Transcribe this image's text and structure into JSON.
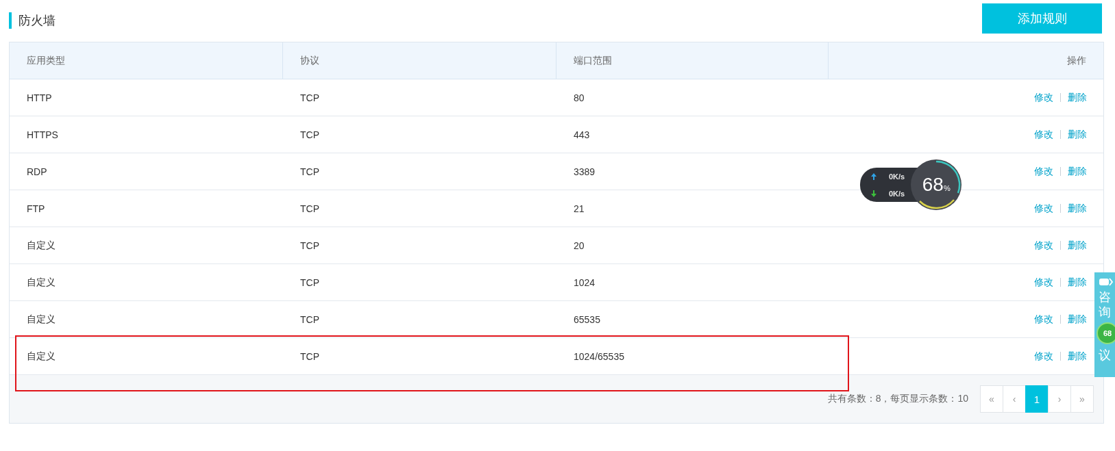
{
  "page_title": "防火墙",
  "add_button": "添加规则",
  "table": {
    "columns": [
      "应用类型",
      "协议",
      "端口范围",
      "操作"
    ],
    "rows": [
      {
        "cells": [
          "HTTP",
          "TCP",
          "80"
        ],
        "actions": [
          "修改",
          "删除"
        ]
      },
      {
        "cells": [
          "HTTPS",
          "TCP",
          "443"
        ],
        "actions": [
          "修改",
          "删除"
        ]
      },
      {
        "cells": [
          "RDP",
          "TCP",
          "3389"
        ],
        "actions": [
          "修改",
          "删除"
        ]
      },
      {
        "cells": [
          "FTP",
          "TCP",
          "21"
        ],
        "actions": [
          "修改",
          "删除"
        ]
      },
      {
        "cells": [
          "自定义",
          "TCP",
          "20"
        ],
        "actions": [
          "修改",
          "删除"
        ]
      },
      {
        "cells": [
          "自定义",
          "TCP",
          "1024"
        ],
        "actions": [
          "修改",
          "删除"
        ]
      },
      {
        "cells": [
          "自定义",
          "TCP",
          "65535"
        ],
        "actions": [
          "修改",
          "删除"
        ]
      },
      {
        "cells": [
          "自定义",
          "TCP",
          "1024/65535"
        ],
        "actions": [
          "修改",
          "删除"
        ]
      }
    ]
  },
  "pagination": {
    "summary": "共有条数：8，每页显示条数：10",
    "buttons": [
      {
        "label": "«",
        "selected": false
      },
      {
        "label": "‹",
        "selected": false
      },
      {
        "label": "1",
        "selected": true
      },
      {
        "label": "›",
        "selected": false
      },
      {
        "label": "»",
        "selected": false
      }
    ]
  },
  "speed_widget": {
    "upload": "0K/s",
    "download": "0K/s",
    "percent": "68",
    "unit": "%"
  },
  "consult_tab": {
    "top_text": "咨询",
    "bottom_text": "议",
    "badge": "68"
  }
}
